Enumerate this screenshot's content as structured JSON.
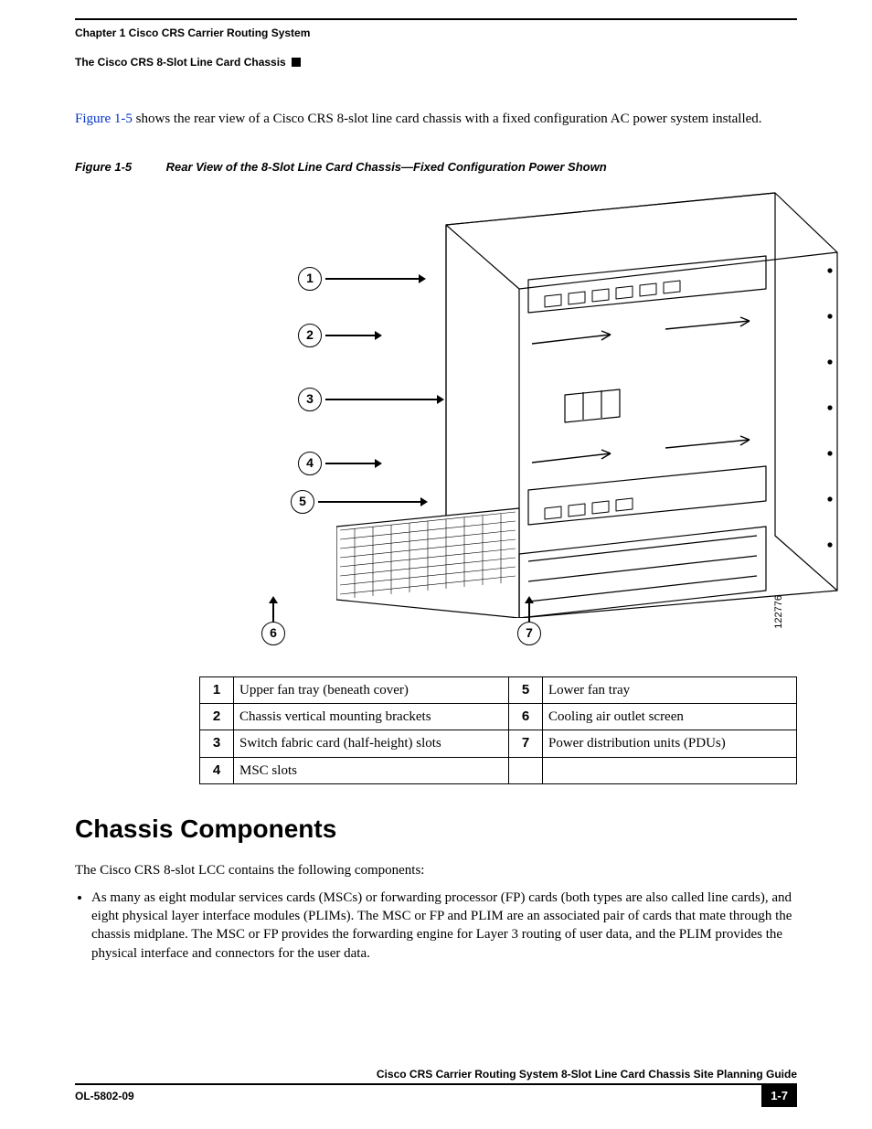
{
  "header": {
    "left_label": "Chapter 1      Cisco CRS Carrier Routing System",
    "right_label": "The Cisco CRS 8-Slot Line Card Chassis"
  },
  "intro": {
    "xref": "Figure 1-5",
    "rest": " shows the rear view of a Cisco CRS 8-slot line card chassis with a fixed configuration AC power system installed."
  },
  "figure": {
    "number": "Figure 1-5",
    "title": "Rear View of the 8-Slot Line Card Chassis—Fixed Configuration Power Shown",
    "image_number": "122776",
    "callouts": [
      "1",
      "2",
      "3",
      "4",
      "5",
      "6",
      "7"
    ],
    "legend": [
      {
        "n": "1",
        "t": "Upper fan tray (beneath cover)",
        "n2": "5",
        "t2": "Lower fan tray"
      },
      {
        "n": "2",
        "t": "Chassis vertical mounting brackets",
        "n2": "6",
        "t2": "Cooling air outlet screen"
      },
      {
        "n": "3",
        "t": "Switch fabric card (half-height) slots",
        "n2": "7",
        "t2": "Power distribution units (PDUs)"
      },
      {
        "n": "4",
        "t": "MSC slots",
        "n2": "",
        "t2": ""
      }
    ]
  },
  "section": {
    "heading": "Chassis Components",
    "lead": "The Cisco CRS 8-slot LCC contains the following components:",
    "bullets": [
      "As many as eight modular services cards (MSCs) or forwarding processor (FP) cards (both types are also called line cards), and eight physical layer interface modules (PLIMs). The MSC or FP and PLIM are an associated pair of cards that mate through the chassis midplane. The MSC or FP provides the forwarding engine for Layer 3 routing of user data, and the PLIM provides the physical interface and connectors for the user data."
    ]
  },
  "footer": {
    "doc_title": "Cisco CRS Carrier Routing System 8-Slot Line Card Chassis Site Planning Guide",
    "doc_number": "OL-5802-09",
    "page": "1-7"
  }
}
